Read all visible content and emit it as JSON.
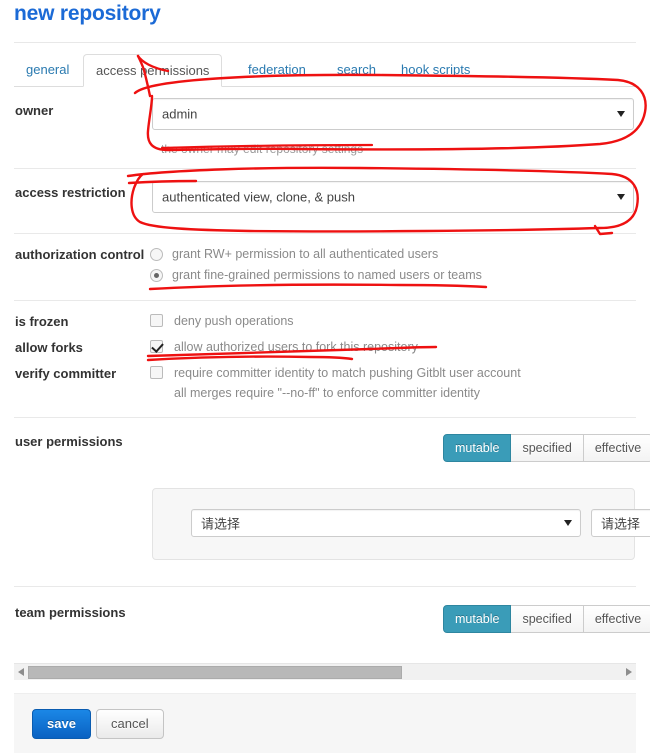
{
  "page": {
    "title": "new repository"
  },
  "tabs": [
    {
      "label": "general",
      "active": false
    },
    {
      "label": "access permissions",
      "active": true
    },
    {
      "label": "federation",
      "active": false
    },
    {
      "label": "search",
      "active": false
    },
    {
      "label": "hook scripts",
      "active": false
    }
  ],
  "form": {
    "owner": {
      "label": "owner",
      "value": "admin",
      "help": "the owner may edit repository settings"
    },
    "access_restriction": {
      "label": "access restriction",
      "value": "authenticated view, clone, & push"
    },
    "authorization_control": {
      "label": "authorization control",
      "options": [
        {
          "text": "grant RW+ permission to all authenticated users",
          "selected": false
        },
        {
          "text": "grant fine-grained permissions to named users or teams",
          "selected": true
        }
      ]
    },
    "is_frozen": {
      "label": "is frozen",
      "option": "deny push operations",
      "checked": false
    },
    "allow_forks": {
      "label": "allow forks",
      "option": "allow authorized users to fork this repository",
      "checked": true
    },
    "verify_committer": {
      "label": "verify committer",
      "option": "require committer identity to match pushing Gitblt user account",
      "option_line2": "all merges require \"--no-ff\" to enforce committer identity",
      "checked": false
    }
  },
  "user_permissions": {
    "label": "user permissions",
    "modes": [
      {
        "label": "mutable",
        "active": true
      },
      {
        "label": "specified",
        "active": false
      },
      {
        "label": "effective",
        "active": false
      }
    ],
    "select_primary": "请选择",
    "select_secondary": "请选择"
  },
  "team_permissions": {
    "label": "team permissions",
    "modes": [
      {
        "label": "mutable",
        "active": true
      },
      {
        "label": "specified",
        "active": false
      },
      {
        "label": "effective",
        "active": false
      }
    ]
  },
  "footer": {
    "save_label": "save",
    "cancel_label": "cancel"
  },
  "colors": {
    "title_blue": "#1b6ad6",
    "tab_link_blue": "#2a7ab0",
    "active_mode_teal": "#3a9cb8",
    "save_blue": "#0a62c2",
    "annotation_red": "#ee1111"
  }
}
